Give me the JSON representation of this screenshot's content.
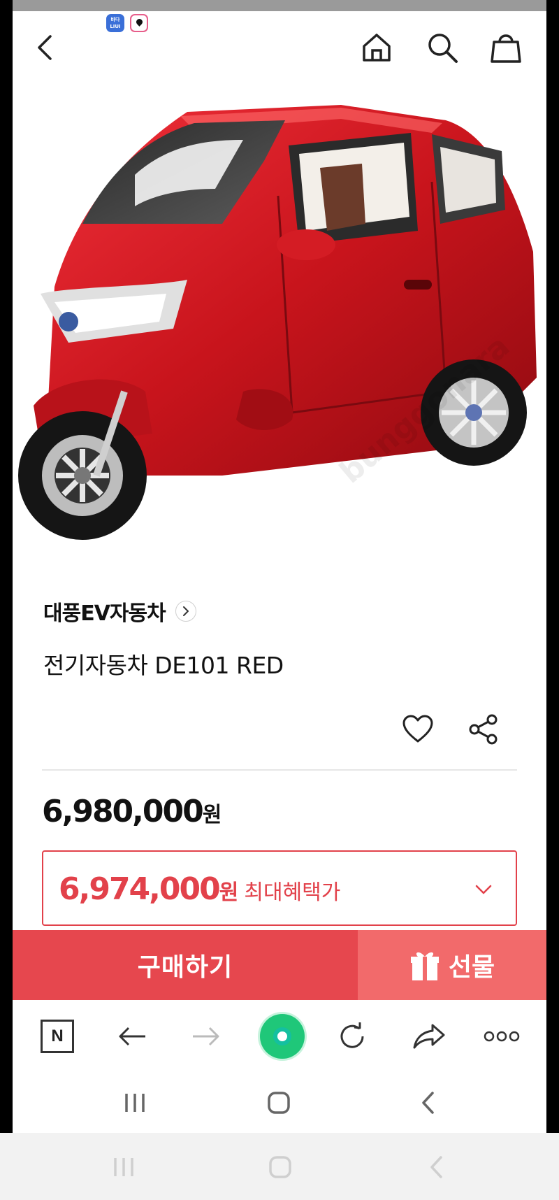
{
  "status_bar": {
    "chip_text": "바다 LIUI"
  },
  "header": {
    "back_icon": "chevron-left-icon",
    "home_icon": "home-icon",
    "search_icon": "search-icon",
    "bag_icon": "shopping-bag-icon"
  },
  "product": {
    "image_alt": "red three-wheel electric car",
    "brand": "대풍EV자동차",
    "name": "전기자동차 DE101 RED",
    "price_number": "6,980,000",
    "price_unit": "원",
    "benefit_number": "6,974,000",
    "benefit_unit": "원",
    "benefit_label": "최대혜택가"
  },
  "buy_bar": {
    "buy_label": "구매하기",
    "gift_label": "선물"
  },
  "browser_toolbar": {
    "naver_label": "N"
  },
  "colors": {
    "accent_red": "#e2414a",
    "buy_red": "#e6474e",
    "gift_red": "#f26a6b",
    "car_red": "#d11a1f",
    "naver_green": "#1fc779"
  }
}
